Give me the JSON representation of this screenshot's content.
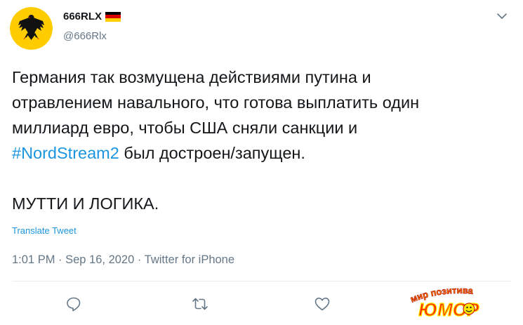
{
  "tweet": {
    "display_name": "666RLX",
    "handle": "@666Rlx",
    "text_lines": [
      "Германия так возмущена действиями путина и",
      "отравлением навального, что готова выплатить один",
      "миллиард евро, чтобы США сняли санкции и"
    ],
    "hashtag": "#NordStream2",
    "line4_rest": " был достроен/запущен.",
    "line_last": "МУТТИ И ЛОГИКА.",
    "translate_label": "Translate Tweet",
    "meta": "1:01 PM · Sep 16, 2020 · Twitter for iPhone"
  },
  "watermark": {
    "top_text": "мир позитива",
    "main_text": "ЮМОР"
  },
  "colors": {
    "accent": "#1b95e0",
    "secondary_text": "#657786",
    "icon": "#657786",
    "divider": "#e6ecf0",
    "flag_black": "#000000",
    "flag_red": "#dd0000",
    "flag_gold": "#ffce00"
  },
  "icons": [
    "coat-of-arms-avatar",
    "german-flag-icon",
    "chevron-down-icon",
    "reply-icon",
    "retweet-icon",
    "like-icon"
  ]
}
